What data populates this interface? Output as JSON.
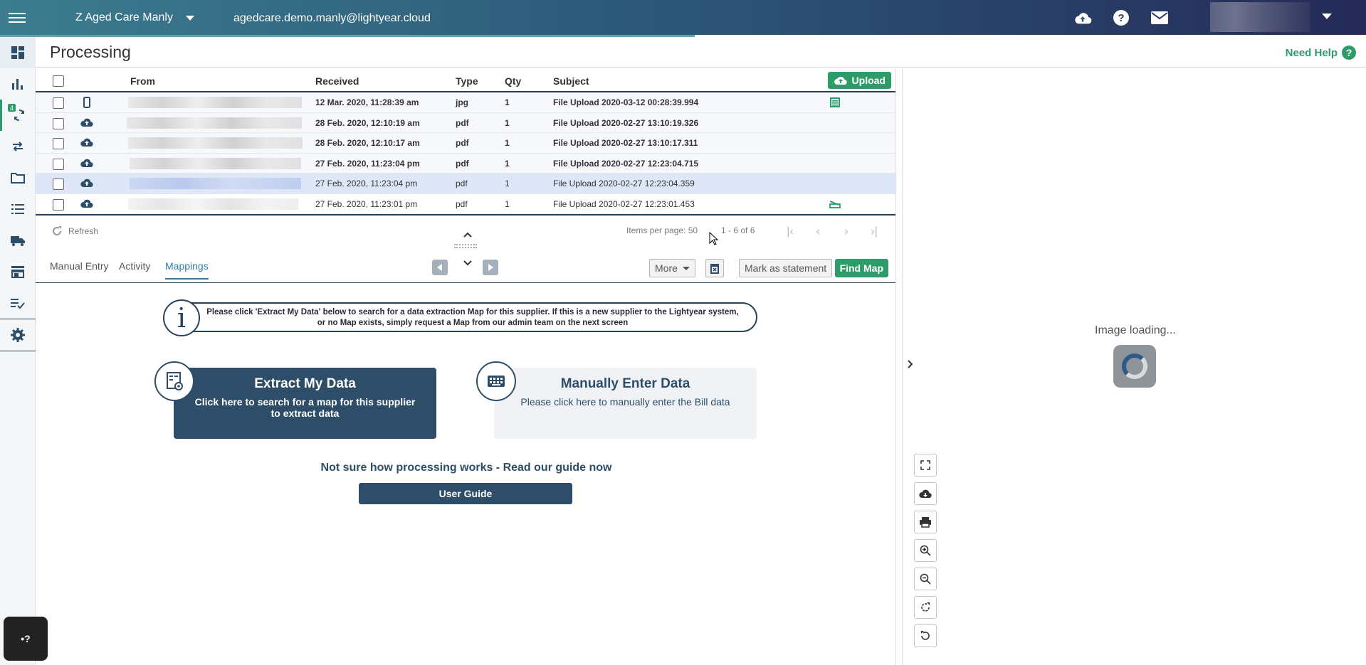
{
  "topbar": {
    "org_name": "Z Aged Care Manly",
    "email": "agedcare.demo.manly@lightyear.cloud",
    "icons": [
      "upload-cloud-icon",
      "help-icon",
      "mail-icon"
    ]
  },
  "page": {
    "title": "Processing",
    "need_help": "Need Help",
    "help_symbol": "?"
  },
  "nav": {
    "badge": "4",
    "items": [
      "dashboard-icon",
      "chart-icon",
      "sync-icon",
      "swap-icon",
      "folder-icon",
      "list-icon",
      "truck-icon",
      "store-icon",
      "checklist-icon",
      "settings-icon"
    ]
  },
  "table": {
    "headers": {
      "from": "From",
      "received": "Received",
      "type": "Type",
      "qty": "Qty",
      "subject": "Subject"
    },
    "upload_label": "Upload",
    "rows": [
      {
        "received": "12 Mar. 2020, 11:28:39 am",
        "type": "jpg",
        "qty": "1",
        "subject": "File Upload 2020-03-12 00:28:39.994",
        "source": "mobile",
        "unread": true
      },
      {
        "received": "28 Feb. 2020, 12:10:19 am",
        "type": "pdf",
        "qty": "1",
        "subject": "File Upload 2020-02-27 13:10:19.326",
        "source": "cloud",
        "unread": true
      },
      {
        "received": "28 Feb. 2020, 12:10:17 am",
        "type": "pdf",
        "qty": "1",
        "subject": "File Upload 2020-02-27 13:10:17.311",
        "source": "cloud",
        "unread": true
      },
      {
        "received": "27 Feb. 2020, 11:23:04 pm",
        "type": "pdf",
        "qty": "1",
        "subject": "File Upload 2020-02-27 12:23:04.715",
        "source": "cloud",
        "unread": true
      },
      {
        "received": "27 Feb. 2020, 11:23:04 pm",
        "type": "pdf",
        "qty": "1",
        "subject": "File Upload 2020-02-27 12:23:04.359",
        "source": "cloud",
        "unread": false
      },
      {
        "received": "27 Feb. 2020, 11:23:01 pm",
        "type": "pdf",
        "qty": "1",
        "subject": "File Upload 2020-02-27 12:23:01.453",
        "source": "cloud",
        "unread": false
      }
    ]
  },
  "pager": {
    "refresh": "Refresh",
    "items_per_page": "Items per page: 50",
    "range": "1 - 6 of 6"
  },
  "tabs": {
    "manual_entry": "Manual Entry",
    "activity": "Activity",
    "mappings": "Mappings",
    "more": "More",
    "mark_statement": "Mark as statement",
    "find_map": "Find Map"
  },
  "mappings": {
    "info_icon": "i",
    "info": "Please click 'Extract My Data' below to search for a data extraction Map for this supplier. If this is a new supplier to the Lightyear system, or no Map exists, simply request a Map from our admin team on the next screen",
    "extract_title": "Extract My Data",
    "extract_desc": "Click here to search for a map for this supplier to extract data",
    "manual_title": "Manually Enter Data",
    "manual_desc": "Please click here to manually enter the Bill data",
    "guide_question": "Not sure how processing works - Read our guide now",
    "user_guide": "User Guide"
  },
  "viewer": {
    "loading": "Image loading...",
    "tools": [
      "fullscreen-icon",
      "download-icon",
      "print-icon",
      "zoom-in-icon",
      "zoom-out-icon",
      "rotate-right-icon",
      "rotate-left-icon"
    ]
  },
  "chat": {
    "label": "•?"
  },
  "colors": {
    "accent": "#2e9c6a",
    "navy": "#2d4d68",
    "link": "#2e7fa0"
  }
}
